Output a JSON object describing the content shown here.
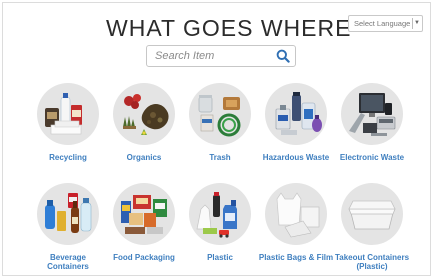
{
  "header": {
    "title": "WHAT GOES WHERE",
    "language_select": "Select Language",
    "language_arrow": "▼"
  },
  "search": {
    "placeholder": "Search Item",
    "icon": "magnifier-icon"
  },
  "categories": [
    {
      "label": "Recycling",
      "icon": "recycling-items-icon"
    },
    {
      "label": "Organics",
      "icon": "organics-items-icon"
    },
    {
      "label": "Trash",
      "icon": "trash-items-icon"
    },
    {
      "label": "Hazardous Waste",
      "icon": "hazardous-waste-icon"
    },
    {
      "label": "Electronic Waste",
      "icon": "electronic-waste-icon"
    },
    {
      "label": "Beverage Containers",
      "icon": "beverage-containers-icon"
    },
    {
      "label": "Food Packaging",
      "icon": "food-packaging-icon"
    },
    {
      "label": "Plastic",
      "icon": "plastic-items-icon"
    },
    {
      "label": "Plastic Bags & Film",
      "icon": "plastic-bags-icon"
    },
    {
      "label": "Takeout Containers (Plastic)",
      "icon": "takeout-container-icon"
    }
  ],
  "colors": {
    "link": "#3f7fbf",
    "circle_bg": "#e4e4e4",
    "title": "#2b2b2b"
  }
}
